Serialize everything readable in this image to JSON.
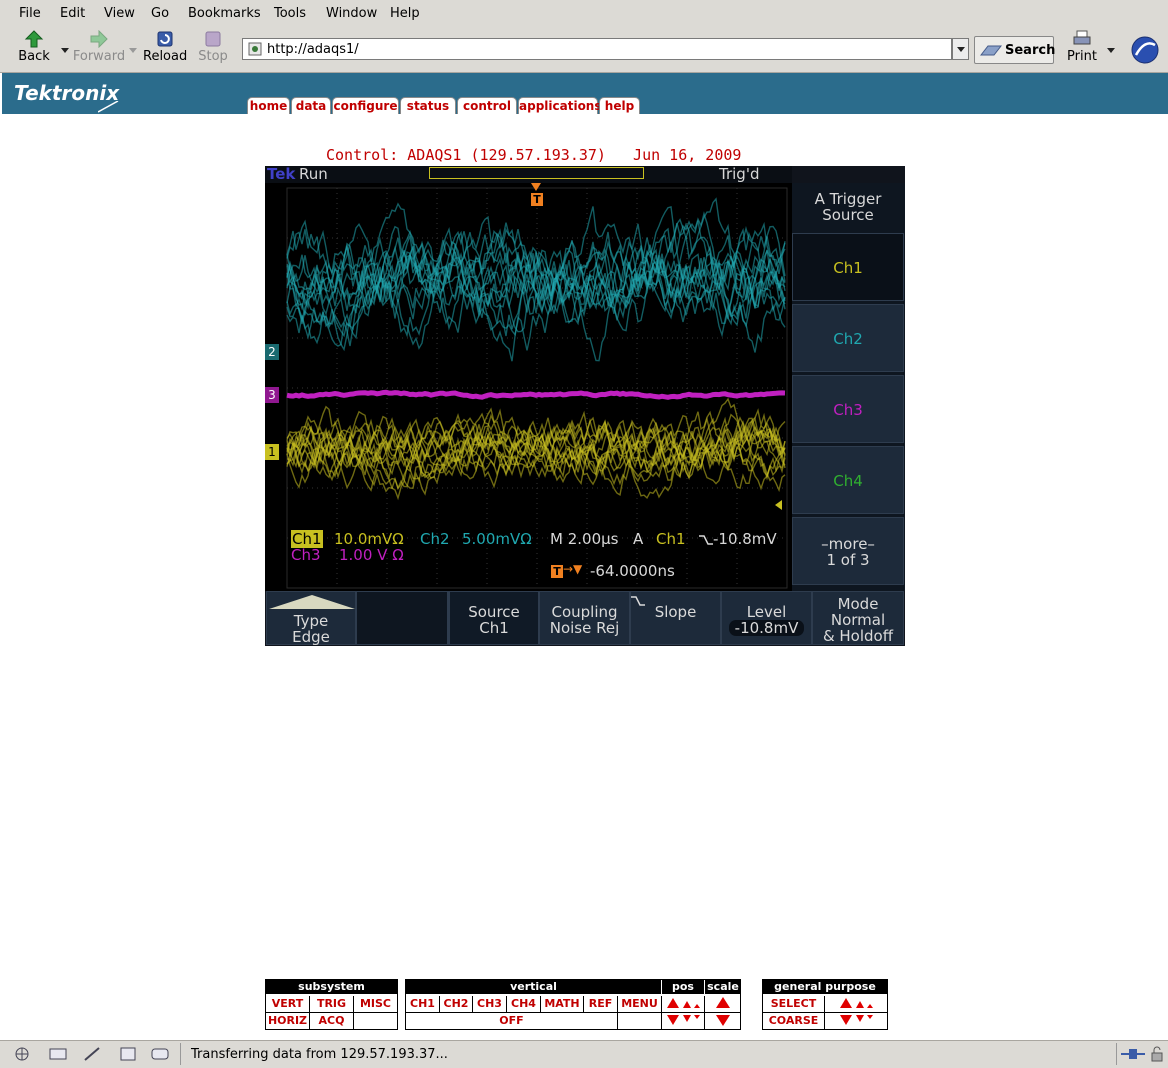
{
  "browser": {
    "menu": [
      "File",
      "Edit",
      "View",
      "Go",
      "Bookmarks",
      "Tools",
      "Window",
      "Help"
    ],
    "nav": {
      "back": "Back",
      "forward": "Forward",
      "reload": "Reload",
      "stop": "Stop",
      "print": "Print",
      "search": "Search"
    },
    "url": "http://adaqs1/",
    "status": "Transferring data from 129.57.193.37..."
  },
  "site": {
    "logo": "Tektronix",
    "tabs": [
      "home",
      "data",
      "configure",
      "status",
      "control",
      "applications",
      "help"
    ]
  },
  "page": {
    "heading": "Control: ADAQS1 (129.57.193.37)   Jun 16, 2009"
  },
  "scope": {
    "colors": {
      "ch1": "#c8c020",
      "ch2": "#20a8b0",
      "ch3": "#c020c0",
      "ch4": "#30b030",
      "accent": "#f08020"
    },
    "top": {
      "tek": "Tek",
      "run": "Run",
      "trigd": "Trig'd"
    },
    "markers": {
      "ch1": "1",
      "ch2": "2",
      "ch3": "3",
      "trigger": "T"
    },
    "readout": {
      "ch1_label": "Ch1",
      "ch1_scale": "10.0mVΩ",
      "ch2_label": "Ch2",
      "ch2_scale": "5.00mVΩ",
      "time": "M 2.00µs",
      "trig_mode": "A",
      "trig_src": "Ch1",
      "trig_level": "-10.8mV",
      "ch3_label": "Ch3",
      "ch3_scale": "1.00 V Ω",
      "delay": "-64.0000ns"
    },
    "side_menu": {
      "title_line1": "A Trigger",
      "title_line2": "Source",
      "buttons": [
        "Ch1",
        "Ch2",
        "Ch3",
        "Ch4"
      ],
      "more_line1": "–more–",
      "more_line2": "1 of 3"
    },
    "bottom_menu": {
      "type_line1": "Type",
      "type_line2": "Edge",
      "source_line1": "Source",
      "source_line2": "Ch1",
      "coupling_line1": "Coupling",
      "coupling_line2": "Noise Rej",
      "slope_line1": "Slope",
      "level_line1": "Level",
      "level_line2": "-10.8mV",
      "mode_line1": "Mode",
      "mode_line2": "Normal",
      "mode_line3": "& Holdoff"
    }
  },
  "control_panel": {
    "subsystem": {
      "title": "subsystem",
      "row1": [
        "VERT",
        "TRIG",
        "MISC"
      ],
      "row2": [
        "HORIZ",
        "ACQ",
        ""
      ]
    },
    "vertical": {
      "title": "vertical",
      "pos": "pos",
      "scale": "scale",
      "buttons": [
        "CH1",
        "CH2",
        "CH3",
        "CH4",
        "MATH",
        "REF",
        "MENU"
      ],
      "off": "OFF"
    },
    "general": {
      "title": "general purpose",
      "select": "SELECT",
      "coarse": "COARSE"
    }
  }
}
